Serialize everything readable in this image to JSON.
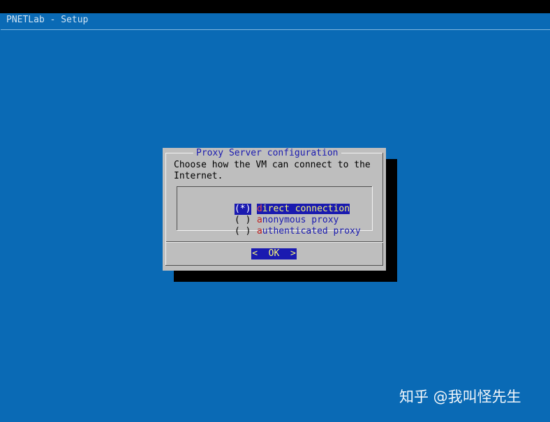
{
  "backtitle": "PNETLab - Setup",
  "dialog": {
    "title": "Proxy Server configuration",
    "prompt_lines": [
      "Choose how the VM can connect to the",
      "Internet."
    ],
    "options": [
      {
        "radio": "(*)",
        "hotkey": "d",
        "rest": "irect connection",
        "selected": true
      },
      {
        "radio": "( )",
        "hotkey": "a",
        "rest": "nonymous proxy",
        "selected": false
      },
      {
        "radio": "( )",
        "hotkey": "a",
        "rest": "uthenticated proxy",
        "selected": false
      }
    ],
    "ok_button": "<  OK  >"
  },
  "watermark": "知乎 @我叫怪先生",
  "colors": {
    "background": "#0A6AB5",
    "dialog": "#BEBEBE",
    "selection": "#1A1AB0",
    "highlight_text": "#F5F57A",
    "hotkey": "#C02020"
  }
}
